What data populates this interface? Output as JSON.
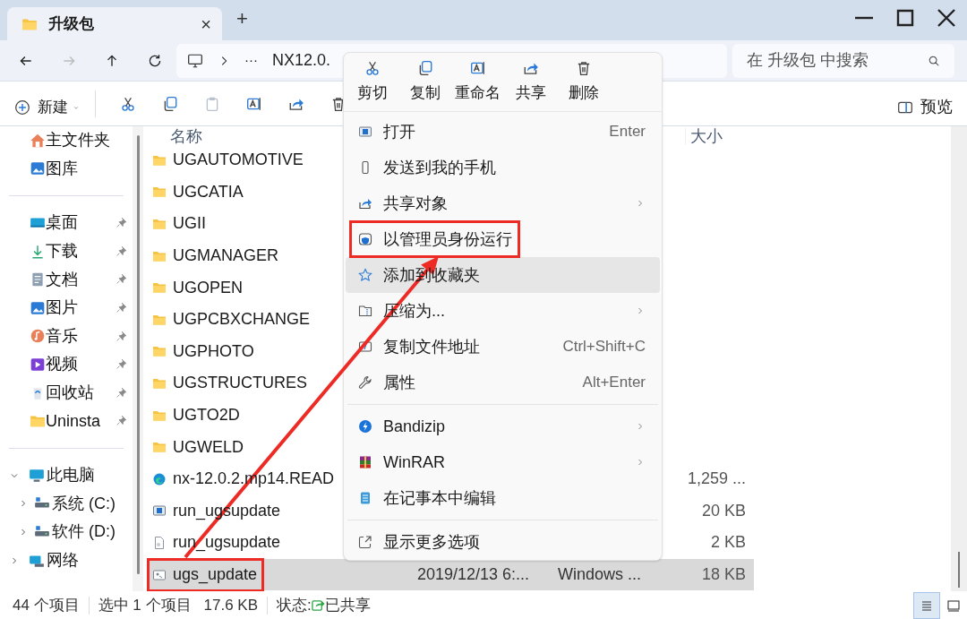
{
  "window": {
    "tab_title": "升级包",
    "tab_close": "×",
    "new_tab": "+"
  },
  "address": {
    "crumb_more": "···",
    "path": "NX12.0."
  },
  "search": {
    "placeholder": "在 升级包 中搜索"
  },
  "command_bar": {
    "new_label": "新建",
    "preview_label": "预览"
  },
  "sidebar": {
    "quick": [
      {
        "label": "主文件夹",
        "pinned": false
      },
      {
        "label": "图库",
        "pinned": false
      }
    ],
    "pinned": [
      {
        "label": "桌面",
        "pinned": true
      },
      {
        "label": "下载",
        "pinned": true
      },
      {
        "label": "文档",
        "pinned": true
      },
      {
        "label": "图片",
        "pinned": true
      },
      {
        "label": "音乐",
        "pinned": true
      },
      {
        "label": "视频",
        "pinned": true
      },
      {
        "label": "回收站",
        "pinned": true
      },
      {
        "label": "Uninsta",
        "pinned": true
      }
    ],
    "tree": [
      {
        "label": "此电脑",
        "expanded": true,
        "children": [
          {
            "label": "系统 (C:)",
            "expanded": false
          },
          {
            "label": "软件 (D:)",
            "expanded": false
          }
        ]
      },
      {
        "label": "网络",
        "expanded": false
      }
    ]
  },
  "table": {
    "columns": [
      "名称",
      "大小"
    ],
    "rows": [
      {
        "name": "UGAUTOMOTIVE",
        "kind": "folder",
        "selected": false,
        "boxed": false
      },
      {
        "name": "UGCATIA",
        "kind": "folder",
        "selected": false,
        "boxed": false
      },
      {
        "name": "UGII",
        "kind": "folder",
        "selected": false,
        "boxed": false
      },
      {
        "name": "UGMANAGER",
        "kind": "folder",
        "selected": false,
        "boxed": false
      },
      {
        "name": "UGOPEN",
        "kind": "folder",
        "selected": false,
        "boxed": false
      },
      {
        "name": "UGPCBXCHANGE",
        "kind": "folder",
        "selected": false,
        "boxed": false
      },
      {
        "name": "UGPHOTO",
        "kind": "folder",
        "selected": false,
        "boxed": false
      },
      {
        "name": "UGSTRUCTURES",
        "kind": "folder",
        "selected": false,
        "boxed": false
      },
      {
        "name": "UGTO2D",
        "kind": "folder",
        "selected": false,
        "boxed": false
      },
      {
        "name": "UGWELD",
        "kind": "folder",
        "selected": false,
        "boxed": false
      },
      {
        "name": "nx-12.0.2.mp14.READ",
        "kind": "webpage",
        "size": "1,259 ...",
        "selected": false,
        "boxed": false
      },
      {
        "name": "run_ugsupdate",
        "kind": "program",
        "size": "20 KB",
        "selected": false,
        "boxed": false
      },
      {
        "name": "run_ugsupdate",
        "kind": "file",
        "size": "2 KB",
        "selected": false,
        "boxed": false
      },
      {
        "name": "ugs_update",
        "kind": "script",
        "date": "2019/12/13 6:...",
        "type": "Windows ...",
        "size": "18 KB",
        "selected": true,
        "boxed": true
      }
    ]
  },
  "context_menu": {
    "actions": [
      "剪切",
      "复制",
      "重命名",
      "共享",
      "删除"
    ],
    "items": [
      {
        "kind": "item",
        "label": "打开",
        "shortcut": "Enter",
        "submenu": false,
        "selected": false,
        "boxed": false
      },
      {
        "kind": "item",
        "label": "发送到我的手机",
        "submenu": false,
        "selected": false,
        "boxed": false
      },
      {
        "kind": "item",
        "label": "共享对象",
        "submenu": true,
        "selected": false,
        "boxed": false
      },
      {
        "kind": "item",
        "label": "以管理员身份运行",
        "submenu": false,
        "selected": false,
        "boxed": true
      },
      {
        "kind": "item",
        "label": "添加到收藏夹",
        "submenu": false,
        "selected": true,
        "boxed": false
      },
      {
        "kind": "item",
        "label": "压缩为...",
        "submenu": true,
        "selected": false,
        "boxed": false
      },
      {
        "kind": "item",
        "label": "复制文件地址",
        "shortcut": "Ctrl+Shift+C",
        "submenu": false,
        "selected": false,
        "boxed": false
      },
      {
        "kind": "item",
        "label": "属性",
        "shortcut": "Alt+Enter",
        "submenu": false,
        "selected": false,
        "boxed": false
      },
      {
        "kind": "separator"
      },
      {
        "kind": "item",
        "label": "Bandizip",
        "submenu": true,
        "selected": false,
        "boxed": false
      },
      {
        "kind": "item",
        "label": "WinRAR",
        "submenu": true,
        "selected": false,
        "boxed": false
      },
      {
        "kind": "item",
        "label": "在记事本中编辑",
        "submenu": false,
        "selected": false,
        "boxed": false
      },
      {
        "kind": "separator"
      },
      {
        "kind": "item",
        "label": "显示更多选项",
        "submenu": false,
        "selected": false,
        "boxed": false
      }
    ]
  },
  "status_bar": {
    "count": "44 个项目",
    "selection": "选中 1 个项目",
    "selection_size": "17.6 KB",
    "state_label": "状态:",
    "state_value": "已共享",
    "views": [
      {
        "selected": true
      },
      {
        "selected": false
      }
    ]
  }
}
